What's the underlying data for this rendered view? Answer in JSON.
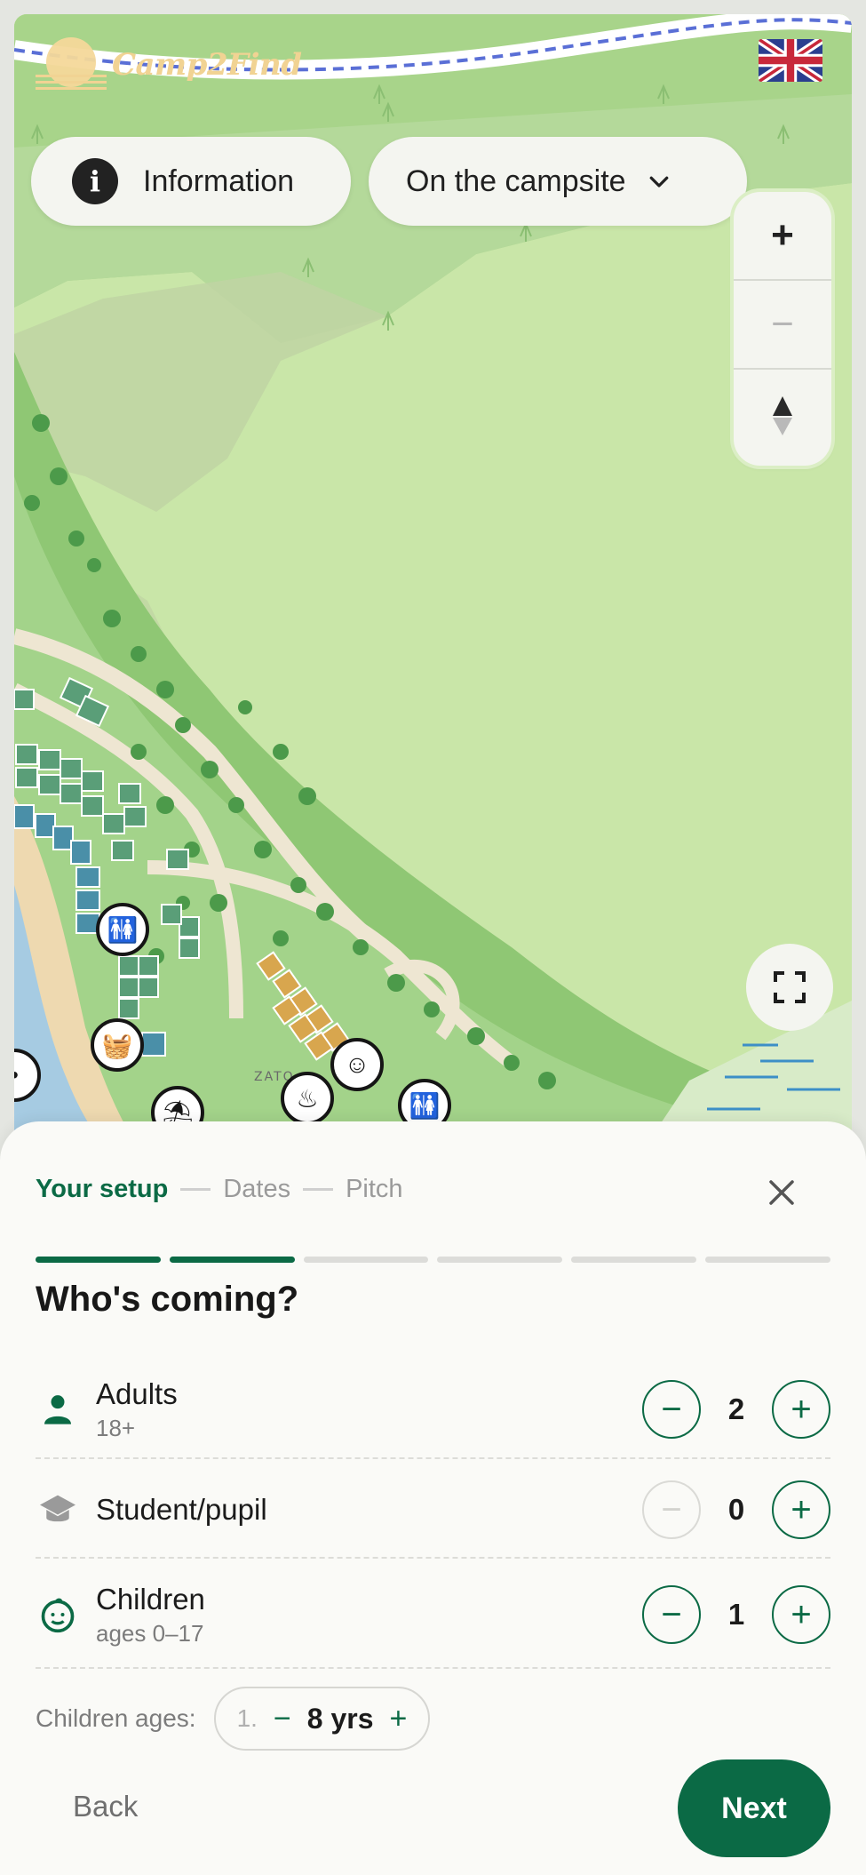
{
  "brand": {
    "name": "Camp2Find"
  },
  "language": {
    "flag": "uk-flag-icon"
  },
  "map": {
    "info_label": "Information",
    "area_label": "On the campsite",
    "zoom_in": "+",
    "zoom_out": "−",
    "compass": "compass-icon",
    "place_label": "ZATO"
  },
  "booking": {
    "steps": [
      "Your setup",
      "Dates",
      "Pitch"
    ],
    "active_step": 0,
    "progress": {
      "total": 6,
      "completed": 2
    },
    "heading": "Who's coming?",
    "guests": [
      {
        "label": "Adults",
        "sub": "18+",
        "count": "2",
        "minus_enabled": true
      },
      {
        "label": "Student/pupil",
        "sub": "",
        "count": "0",
        "minus_enabled": false
      },
      {
        "label": "Children",
        "sub": "ages 0–17",
        "count": "1",
        "minus_enabled": true
      }
    ],
    "children_ages": {
      "label": "Children ages:",
      "index": "1.",
      "value": "8 yrs"
    },
    "back_label": "Back",
    "next_label": "Next"
  },
  "colors": {
    "accent": "#0b6a45",
    "sheet_bg": "#fafaf7",
    "map_green": "#c9e6a8",
    "map_dark_green": "#8fc774",
    "pitch_green": "#5a9e78",
    "pitch_blue": "#4a8fa8",
    "pitch_orange": "#d8a64e"
  }
}
